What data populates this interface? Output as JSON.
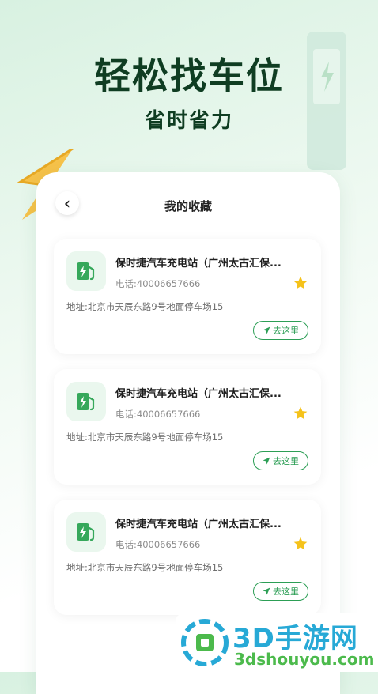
{
  "promo": {
    "headline": "轻松找车位",
    "subline": "省时省力"
  },
  "header": {
    "title": "我的收藏",
    "back_icon": "‹"
  },
  "colors": {
    "accent": "#2c9e55",
    "star": "#f5c21b",
    "headline": "#0f3d22"
  },
  "favorites": [
    {
      "name": "保时捷汽车充电站（广州太古汇保...",
      "phone": "电话:40006657666",
      "address": "地址:北京市天辰东路9号地面停车场15",
      "go_label": "去这里",
      "icon": "ev-charger-icon",
      "starred": true
    },
    {
      "name": "保时捷汽车充电站（广州太古汇保...",
      "phone": "电话:40006657666",
      "address": "地址:北京市天辰东路9号地面停车场15",
      "go_label": "去这里",
      "icon": "ev-charger-icon",
      "starred": true
    },
    {
      "name": "保时捷汽车充电站（广州太古汇保...",
      "phone": "电话:40006657666",
      "address": "地址:北京市天辰东路9号地面停车场15",
      "go_label": "去这里",
      "icon": "ev-charger-icon",
      "starred": true
    }
  ],
  "watermark": {
    "name": "3D手游网",
    "domain": "3dshouyou.com"
  }
}
